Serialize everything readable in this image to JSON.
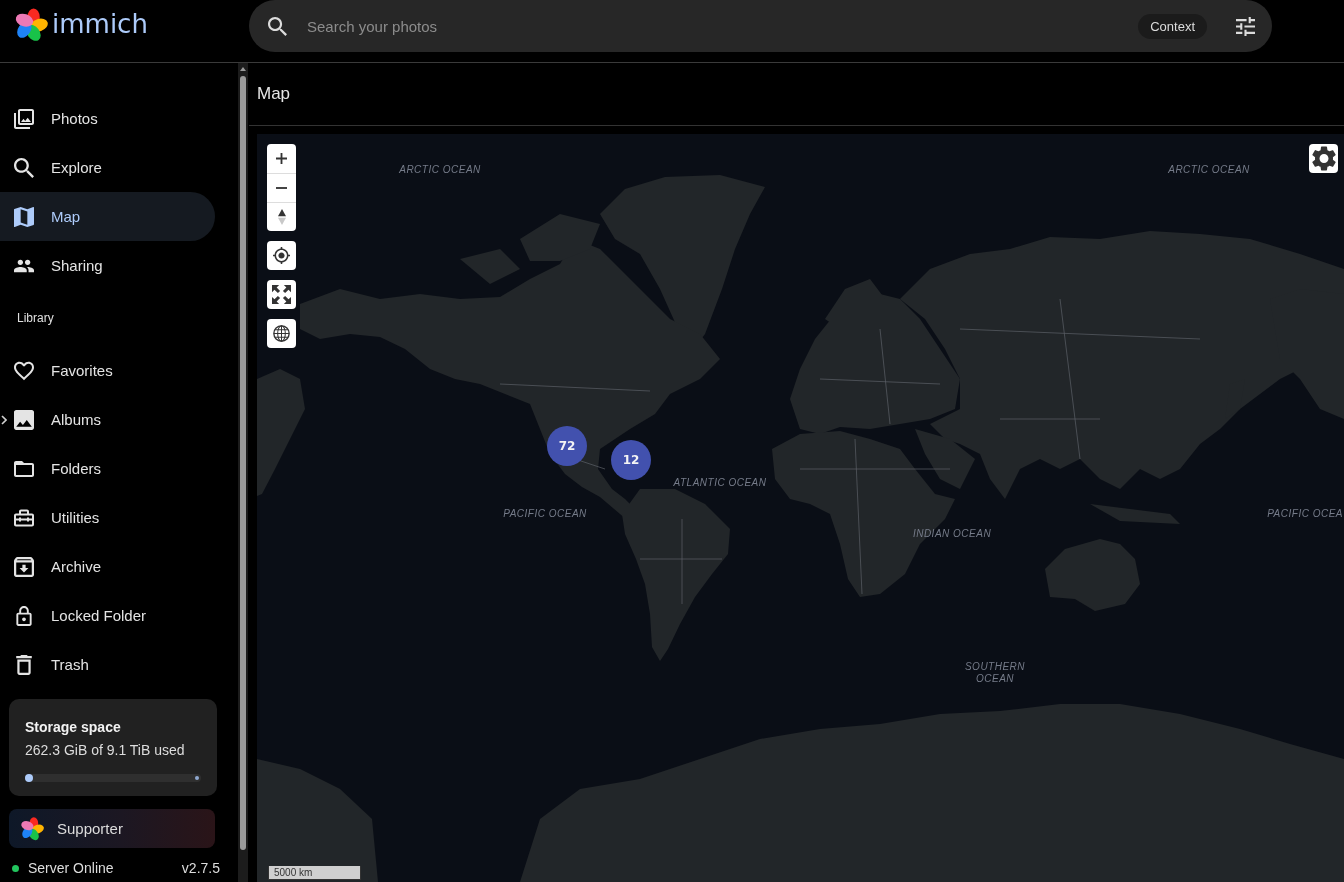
{
  "app": {
    "name": "immich"
  },
  "search": {
    "placeholder": "Search your photos",
    "mode": "Context"
  },
  "sidebar": {
    "main_items": [
      {
        "label": "Photos",
        "selected": false
      },
      {
        "label": "Explore",
        "selected": false
      },
      {
        "label": "Map",
        "selected": true
      },
      {
        "label": "Sharing",
        "selected": false
      }
    ],
    "section_title": "Library",
    "library_items": [
      {
        "label": "Favorites",
        "selected": false
      },
      {
        "label": "Albums",
        "selected": false,
        "expanded": false
      },
      {
        "label": "Folders",
        "selected": false
      },
      {
        "label": "Utilities",
        "selected": false
      },
      {
        "label": "Archive",
        "selected": false
      },
      {
        "label": "Locked Folder",
        "selected": false
      },
      {
        "label": "Trash",
        "selected": false
      }
    ],
    "storage": {
      "title": "Storage space",
      "usage": "262.3 GiB of 9.1 TiB used",
      "level": 0.03
    },
    "supporter": {
      "label": "Supporter"
    },
    "server": {
      "status": "Server Online",
      "online": true,
      "version": "v2.7.5"
    }
  },
  "page": {
    "title": "Map"
  },
  "map": {
    "clusters": [
      {
        "count": "72"
      },
      {
        "count": "12"
      }
    ],
    "ocean_labels": [
      "ARCTIC OCEAN",
      "ARCTIC OCEAN",
      "ATLANTIC OCEAN",
      "PACIFIC OCEAN",
      "PACIFIC OCEA",
      "INDIAN OCEAN",
      "SOUTHERN OCEAN"
    ],
    "scale": "5000 km"
  }
}
